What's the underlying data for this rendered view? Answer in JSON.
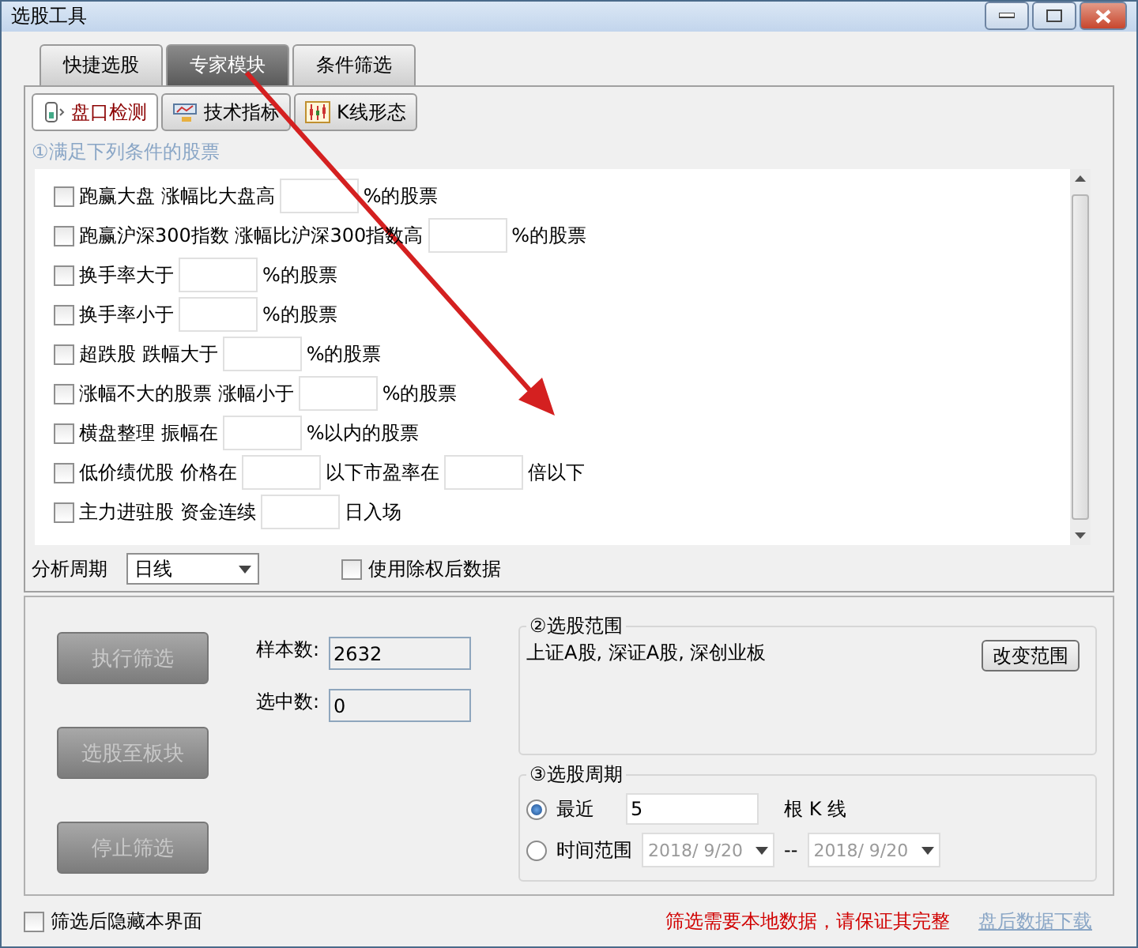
{
  "window": {
    "title": "选股工具"
  },
  "tabs": [
    {
      "label": "快捷选股",
      "selected": false
    },
    {
      "label": "专家模块",
      "selected": true
    },
    {
      "label": "条件筛选",
      "selected": false
    }
  ],
  "subtabs": [
    {
      "label": "盘口检测",
      "selected": true,
      "kind": "gauge"
    },
    {
      "label": "技术指标",
      "selected": false,
      "kind": "chart"
    },
    {
      "label": "K线形态",
      "selected": false,
      "kind": "candle"
    }
  ],
  "conditions_title": "①满足下列条件的股票",
  "conditions": [
    {
      "checked": false,
      "parts": [
        {
          "kind": "text",
          "text": "跑赢大盘 涨幅比大盘高"
        },
        {
          "kind": "field"
        },
        {
          "kind": "text",
          "text": "%的股票"
        }
      ]
    },
    {
      "checked": false,
      "parts": [
        {
          "kind": "text",
          "text": "跑赢沪深300指数 涨幅比沪深300指数高"
        },
        {
          "kind": "field"
        },
        {
          "kind": "text",
          "text": "%的股票"
        }
      ]
    },
    {
      "checked": false,
      "parts": [
        {
          "kind": "text",
          "text": "换手率大于"
        },
        {
          "kind": "field"
        },
        {
          "kind": "text",
          "text": "%的股票"
        }
      ]
    },
    {
      "checked": false,
      "parts": [
        {
          "kind": "text",
          "text": "换手率小于"
        },
        {
          "kind": "field"
        },
        {
          "kind": "text",
          "text": "%的股票"
        }
      ]
    },
    {
      "checked": false,
      "parts": [
        {
          "kind": "text",
          "text": "超跌股 跌幅大于"
        },
        {
          "kind": "field"
        },
        {
          "kind": "text",
          "text": "%的股票"
        }
      ]
    },
    {
      "checked": false,
      "parts": [
        {
          "kind": "text",
          "text": "涨幅不大的股票 涨幅小于"
        },
        {
          "kind": "field"
        },
        {
          "kind": "text",
          "text": "%的股票"
        }
      ]
    },
    {
      "checked": false,
      "parts": [
        {
          "kind": "text",
          "text": "横盘整理 振幅在"
        },
        {
          "kind": "field"
        },
        {
          "kind": "text",
          "text": "%以内的股票"
        }
      ]
    },
    {
      "checked": false,
      "parts": [
        {
          "kind": "text",
          "text": "低价绩优股 价格在"
        },
        {
          "kind": "field"
        },
        {
          "kind": "text",
          "text": "以下市盈率在"
        },
        {
          "kind": "field"
        },
        {
          "kind": "text",
          "text": "倍以下"
        }
      ]
    },
    {
      "checked": false,
      "parts": [
        {
          "kind": "text",
          "text": "主力进驻股 资金连续"
        },
        {
          "kind": "field"
        },
        {
          "kind": "text",
          "text": "日入场"
        }
      ]
    }
  ],
  "period": {
    "label": "分析周期",
    "value": "日线",
    "adjusted": {
      "label": "使用除权后数据",
      "checked": false
    }
  },
  "actions": [
    {
      "label": "执行筛选",
      "disabled": true
    },
    {
      "label": "选股至板块",
      "disabled": true
    },
    {
      "label": "停止筛选",
      "disabled": true
    }
  ],
  "stats": [
    {
      "label": "样本数:",
      "value": "2632"
    },
    {
      "label": "选中数:",
      "value": "0"
    }
  ],
  "scope": {
    "title": "②选股范围",
    "text": "上证A股, 深证A股, 深创业板",
    "button": "改变范围"
  },
  "cycle": {
    "title": "③选股周期",
    "options": [
      {
        "kind": "count",
        "label": "最近",
        "selected": true,
        "value": "5",
        "unit": "根 K 线"
      },
      {
        "kind": "range",
        "label": "时间范围",
        "selected": false,
        "from": "2018/ 9/20",
        "separator": "--",
        "to": "2018/ 9/20"
      }
    ]
  },
  "footer": {
    "hide": {
      "label": "筛选后隐藏本界面",
      "checked": false
    },
    "notice": "筛选需要本地数据，请保证其完整",
    "link": "盘后数据下载"
  }
}
